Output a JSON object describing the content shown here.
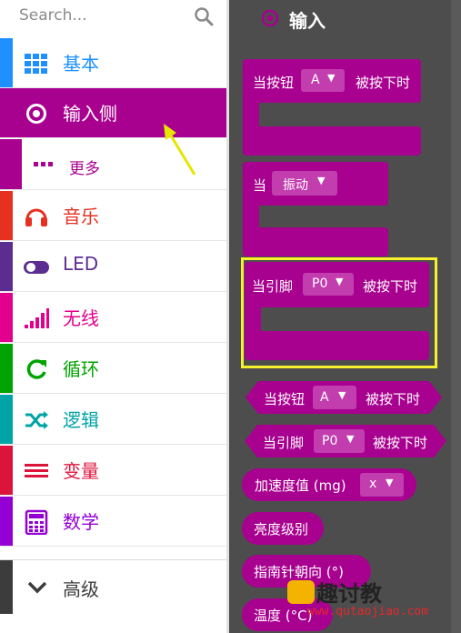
{
  "search": {
    "placeholder": "Search..."
  },
  "categories": [
    {
      "label": "基本",
      "icon": "grid-icon",
      "color": "#1e90ff"
    },
    {
      "label": "输入侧",
      "icon": "radio-target-icon",
      "color": "#a8008f"
    },
    {
      "label": "音乐",
      "icon": "headphones-icon",
      "color": "#e63022"
    },
    {
      "label": "LED",
      "icon": "toggle-icon",
      "color": "#5c2d91"
    },
    {
      "label": "无线",
      "icon": "signal-bars-icon",
      "color": "#e3008c"
    },
    {
      "label": "循环",
      "icon": "refresh-icon",
      "color": "#00a400"
    },
    {
      "label": "逻辑",
      "icon": "shuffle-icon",
      "color": "#00a4a6"
    },
    {
      "label": "变量",
      "icon": "lines-icon",
      "color": "#dc143c"
    },
    {
      "label": "数学",
      "icon": "calculator-icon",
      "color": "#9400d3"
    }
  ],
  "more": {
    "label": "更多",
    "icon": "ellipsis-icon"
  },
  "advanced": {
    "label": "高级",
    "icon": "chevron-down-icon"
  },
  "workspace": {
    "title": "输入",
    "blocks": {
      "button": {
        "prefix": "当按钮",
        "value": "A",
        "suffix": "被按下时"
      },
      "gesture": {
        "prefix": "当",
        "value": "振动"
      },
      "pin": {
        "prefix": "当引脚",
        "value": "P0",
        "suffix": "被按下时"
      },
      "button_pressed": {
        "prefix": "当按钮",
        "value": "A",
        "suffix": "被按下时"
      },
      "pin_pressed": {
        "prefix": "当引脚",
        "value": "P0",
        "suffix": "被按下时"
      },
      "accel": {
        "prefix": "加速度值 (mg)",
        "value": "x"
      },
      "light": {
        "label": "亮度级别"
      },
      "compass": {
        "label": "指南针朝向 (°)"
      },
      "temperature": {
        "label": "温度 (°C)"
      }
    }
  },
  "watermark": {
    "text": "趣讨教",
    "url": "www.qutaojiao.com"
  },
  "colors": {
    "input": "#a8008f",
    "workspace": "#4d4d4d",
    "highlight": "#f6f02d",
    "arrow": "#e6e600"
  }
}
